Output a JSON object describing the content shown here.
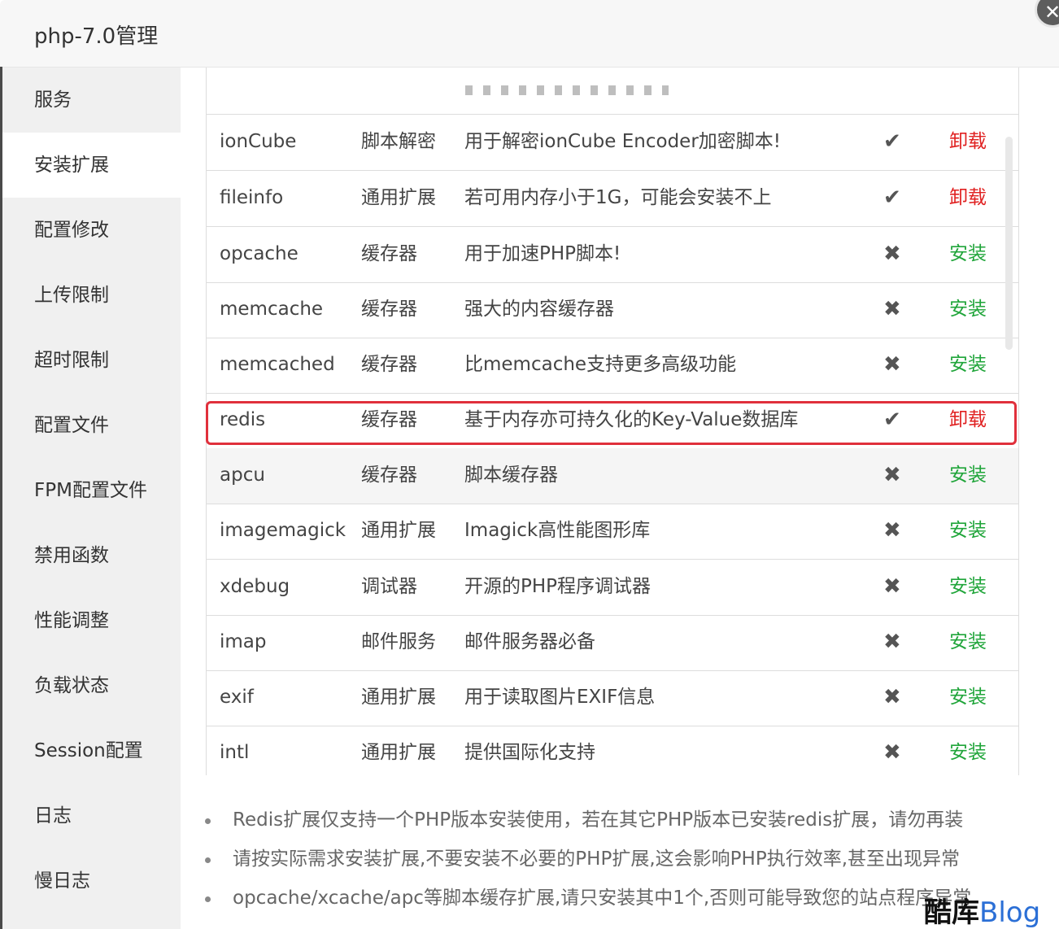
{
  "window": {
    "title": "php-7.0管理",
    "close_glyph": "✕"
  },
  "sidebar": {
    "items": [
      {
        "label": "服务",
        "active": false
      },
      {
        "label": "安装扩展",
        "active": true
      },
      {
        "label": "配置修改",
        "active": false
      },
      {
        "label": "上传限制",
        "active": false
      },
      {
        "label": "超时限制",
        "active": false
      },
      {
        "label": "配置文件",
        "active": false
      },
      {
        "label": "FPM配置文件",
        "active": false
      },
      {
        "label": "禁用函数",
        "active": false
      },
      {
        "label": "性能调整",
        "active": false
      },
      {
        "label": "负载状态",
        "active": false
      },
      {
        "label": "Session配置",
        "active": false
      },
      {
        "label": "日志",
        "active": false
      },
      {
        "label": "慢日志",
        "active": false
      }
    ]
  },
  "extensions": {
    "rows": [
      {
        "name": "ionCube",
        "type": "脚本解密",
        "desc": "用于解密ionCube Encoder加密脚本!",
        "status": "✔",
        "action": "卸载",
        "installed": true
      },
      {
        "name": "fileinfo",
        "type": "通用扩展",
        "desc": "若可用内存小于1G，可能会安装不上",
        "status": "✔",
        "action": "卸载",
        "installed": true
      },
      {
        "name": "opcache",
        "type": "缓存器",
        "desc": "用于加速PHP脚本!",
        "status": "✖",
        "action": "安装",
        "installed": false
      },
      {
        "name": "memcache",
        "type": "缓存器",
        "desc": "强大的内容缓存器",
        "status": "✖",
        "action": "安装",
        "installed": false
      },
      {
        "name": "memcached",
        "type": "缓存器",
        "desc": "比memcache支持更多高级功能",
        "status": "✖",
        "action": "安装",
        "installed": false
      },
      {
        "name": "redis",
        "type": "缓存器",
        "desc": "基于内存亦可持久化的Key-Value数据库",
        "status": "✔",
        "action": "卸载",
        "installed": true
      },
      {
        "name": "apcu",
        "type": "缓存器",
        "desc": "脚本缓存器",
        "status": "✖",
        "action": "安装",
        "installed": false
      },
      {
        "name": "imagemagick",
        "type": "通用扩展",
        "desc": "Imagick高性能图形库",
        "status": "✖",
        "action": "安装",
        "installed": false
      },
      {
        "name": "xdebug",
        "type": "调试器",
        "desc": "开源的PHP程序调试器",
        "status": "✖",
        "action": "安装",
        "installed": false
      },
      {
        "name": "imap",
        "type": "邮件服务",
        "desc": "邮件服务器必备",
        "status": "✖",
        "action": "安装",
        "installed": false
      },
      {
        "name": "exif",
        "type": "通用扩展",
        "desc": "用于读取图片EXIF信息",
        "status": "✖",
        "action": "安装",
        "installed": false
      },
      {
        "name": "intl",
        "type": "通用扩展",
        "desc": "提供国际化支持",
        "status": "✖",
        "action": "安装",
        "installed": false
      }
    ]
  },
  "notes": [
    "Redis扩展仅支持一个PHP版本安装使用，若在其它PHP版本已安装redis扩展，请勿再装",
    "请按实际需求安装扩展,不要安装不必要的PHP扩展,这会影响PHP执行效率,甚至出现异常",
    "opcache/xcache/apc等脚本缓存扩展,请只安装其中1个,否则可能导致您的站点程序异常"
  ],
  "watermark": {
    "part1": "酷库",
    "part2": "Blog"
  },
  "colors": {
    "uninstall": "#e02020",
    "install": "#20a53a",
    "highlight": "#e0303c"
  }
}
